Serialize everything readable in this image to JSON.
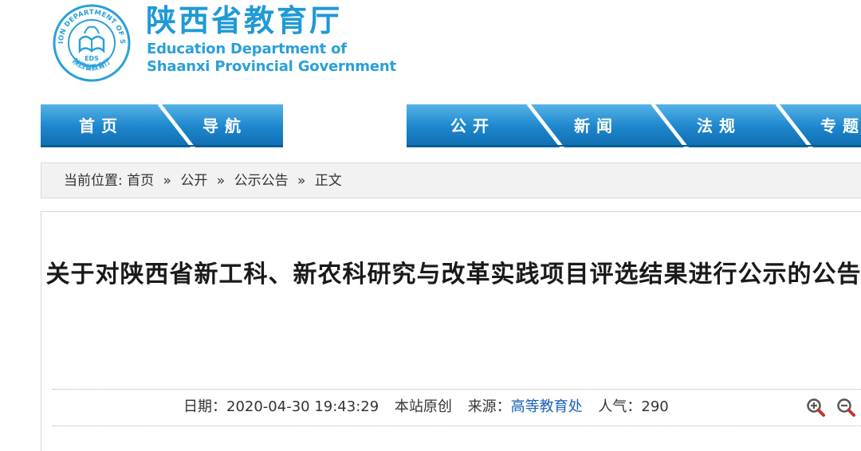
{
  "header": {
    "logo": {
      "ring_text": "EDUCATION DEPARTMENT OF SHAANXI",
      "monogram": "EDS",
      "bottom_text": "陕西省教育厅"
    },
    "title_cn": "陕西省教育厅",
    "title_en_line1": "Education Department of",
    "title_en_line2": "Shaanxi Provincial Government"
  },
  "nav": {
    "items": [
      {
        "label": "首页"
      },
      {
        "label": "导航"
      },
      {
        "label": "公开"
      },
      {
        "label": "新闻"
      },
      {
        "label": "法规"
      },
      {
        "label": "专题"
      }
    ],
    "colors": {
      "top": "#4aa8de",
      "bottom": "#0f6cae"
    }
  },
  "breadcrumb": {
    "prefix": "当前位置:",
    "items": [
      "首页",
      "公开",
      "公示公告",
      "正文"
    ],
    "separator": "»"
  },
  "article": {
    "title": "关于对陕西省新工科、新农科研究与改革实践项目评选结果进行公示的公告",
    "meta": {
      "date_label": "日期：",
      "date": "2020-04-30 19:43:29",
      "origin": "本站原创",
      "source_label": "来源：",
      "source": "高等教育处",
      "views_label": "人气：",
      "views": "290"
    },
    "tools": {
      "zoom_in_icon": "zoom-in-icon",
      "zoom_out_icon": "zoom-out-icon"
    }
  },
  "colors": {
    "brand": "#1f9ad6",
    "link": "#1a5fb4",
    "nav": "#1781c6"
  }
}
